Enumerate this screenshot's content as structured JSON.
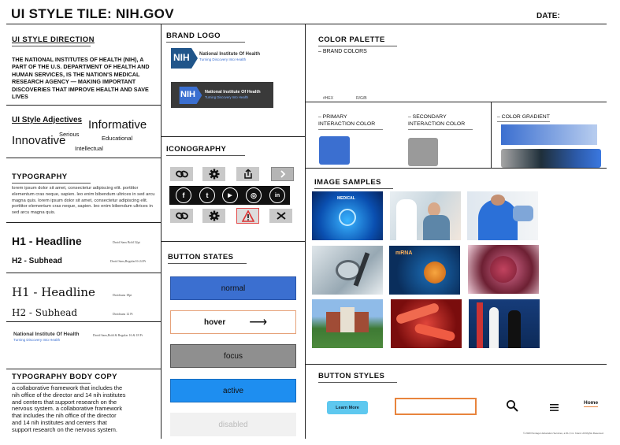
{
  "header": {
    "title": "UI STYLE TILE: NIH.GOV",
    "date_label": "DATE:"
  },
  "direction": {
    "title": "UI STYLE DIRECTION",
    "text": "THE NATIONAL INSTITUTES OF HEALTH (NIH), A PART OF THE U.S. DEPARTMENT OF HEALTH AND HUMAN SERVICES, IS THE NATION'S MEDICAL RESEARCH AGENCY — MAKING IMPORTANT DISCOVERIES THAT IMPROVE HEALTH AND SAVE LIVES"
  },
  "adjectives": {
    "title": "UI Style Adjectives",
    "words": [
      "Informative",
      "Serious",
      "Educational",
      "Innovative",
      "Intellectual"
    ]
  },
  "typography": {
    "title": "TYPOGRAPHY",
    "sample": "lorem ipsum dolor sit amet, consectetur adipiscing elit. porttitor elementum cras neque, sapien. leo enim bibendum ultrices in sed arcu magna quis. lorem ipsum dolor sit amet, consectetur adipiscing elit. porttitor elementum cras neque, sapien. leo enim bibendum ultrices in sed arcu magna quis.",
    "h1_a": "H1 - Headline",
    "h1_a_note": "Droid Sans Bold 32pt",
    "h2_a": "H2 - Subhead",
    "h2_a_note": "Droid Sans,Regular16-24 Pt",
    "h1_b": "H1 - Headline",
    "h1_b_note": "Droidsans 18pt",
    "h2_b": "H2 - Subhead",
    "h2_b_note": "Droidsans 12 Pt",
    "brand_name": "National Institute Of Health",
    "brand_tag": "Turning Discovery Into Health",
    "brand_note": "Droid Sans,Bold & Regular 16 & 18 Pt"
  },
  "body_copy": {
    "title": "TYPOGRAPHY BODY COPY",
    "text": "a collaborative framework that includes the nih office of the director and 14 nih institutes and centers that support research on the nervous system.    a collaborative framework that includes the nih office of the director and 14 nih institutes and centers that support research on the nervous system."
  },
  "brand_logo": {
    "title": "BRAND LOGO",
    "mark": "NIH",
    "name": "National Institute Of Health",
    "tagline": "Turning Discovery Into Health"
  },
  "iconography": {
    "title": "ICONOGRAPHY",
    "social": [
      "f",
      "t",
      "▶",
      "◎",
      "in"
    ]
  },
  "button_states": {
    "title": "BUTTON STATES",
    "normal": "normal",
    "hover": "hover",
    "hover_arrow": "⟶",
    "focus": "focus",
    "active": "active",
    "disabled": "disabled"
  },
  "color_palette": {
    "title": "COLOR PALETTE",
    "brand_colors": "– BRAND COLORS",
    "hex_label": "#HEX",
    "rgb_label": "R/G/B",
    "primary_label": "– PRIMARY INTERACTION COLOR",
    "secondary_label": "– SECONDARY INTERACTION COLOR",
    "gradient_label": "– COLOR GRADIENT",
    "primary_color": "#3b6fd0",
    "secondary_color": "#9a9a9a"
  },
  "image_samples": {
    "title": "IMAGE SAMPLES",
    "caption_medical": "MEDICAL",
    "caption_rna": "mRNA"
  },
  "button_styles": {
    "title": "BUTTON STYLES",
    "learn_more": "Learn More",
    "home": "Home"
  },
  "footer": {
    "copyright": "© 2020 Pentagon Education Services, a DLI, Inc. brand. All Rights Reserved."
  }
}
